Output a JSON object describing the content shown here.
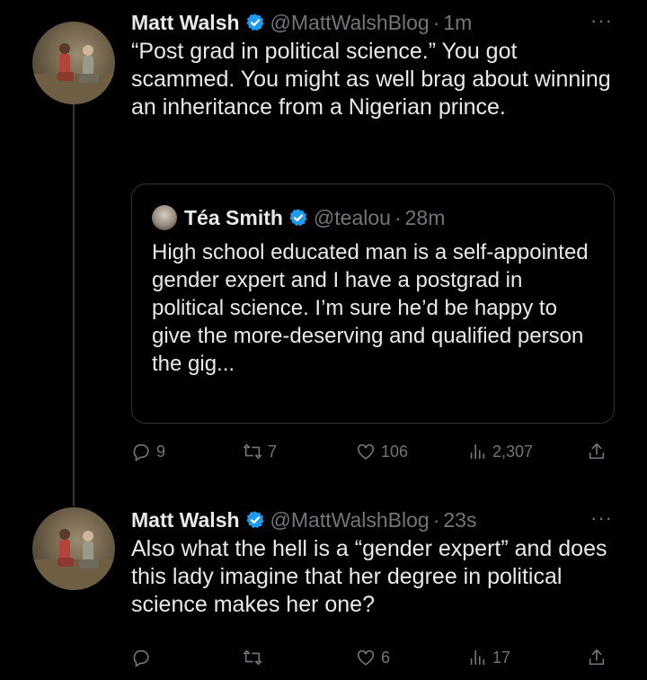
{
  "tweets": [
    {
      "name": "Matt Walsh",
      "handle": "@MattWalshBlog",
      "dot": "·",
      "time": "1m",
      "more": "···",
      "text": "“Post grad in political science.” You got scammed. You might as well brag about winning an inheritance from a Nigerian prince.",
      "quote": {
        "name": "Téa Smith",
        "handle": "@tealou",
        "dot": "·",
        "time": "28m",
        "text": "High school educated man is a self-appointed gender expert and I have a postgrad in political science. I’m sure he’d be happy to give the more-deserving and qualified person the gig..."
      },
      "actions": {
        "replies": "9",
        "retweets": "7",
        "likes": "106",
        "views": "2,307"
      }
    },
    {
      "name": "Matt Walsh",
      "handle": "@MattWalshBlog",
      "dot": "·",
      "time": "23s",
      "more": "···",
      "text": "Also what the hell is a “gender expert” and does this lady imagine that her degree in political science makes her one?",
      "actions": {
        "replies": "",
        "retweets": "",
        "likes": "6",
        "views": "17"
      }
    }
  ],
  "colors": {
    "background": "#000000",
    "text": "#e7e9ea",
    "muted": "#71767b",
    "verified": "#1d9bf0",
    "border": "#2f3336"
  },
  "icons": [
    "verified-badge-icon",
    "reply-icon",
    "retweet-icon",
    "like-icon",
    "views-icon",
    "share-icon",
    "more-icon"
  ]
}
